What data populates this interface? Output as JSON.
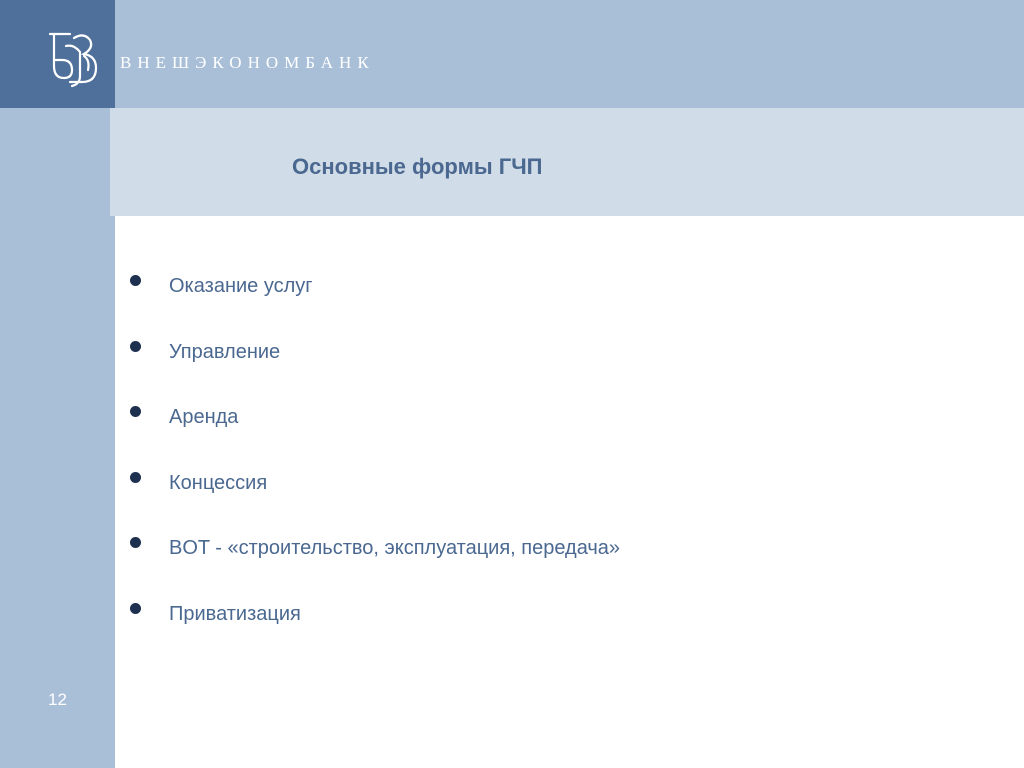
{
  "header": {
    "bank_name": "ВНЕШЭКОНОМБАНК"
  },
  "slide": {
    "title": "Основные формы ГЧП",
    "bullets": [
      "Оказание услуг",
      "Управление",
      "Аренда",
      "Концессия",
      "BOT - «строительство, эксплуатация, передача»",
      "Приватизация"
    ],
    "page_number": "12"
  },
  "colors": {
    "logo_block": "#4f709a",
    "band": "#a9bfd8",
    "title_band": "#d0dce7",
    "text": "#4a6890",
    "bullet": "#1e3050"
  }
}
